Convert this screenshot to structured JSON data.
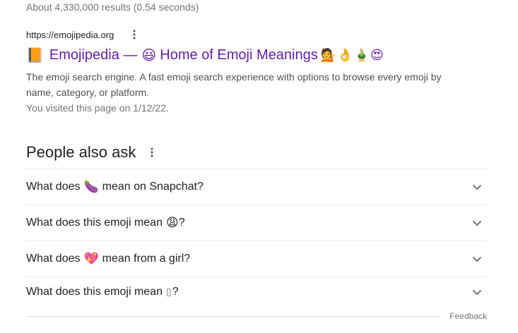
{
  "stats": "About 4,330,000 results (0.54 seconds)",
  "result": {
    "url": "https://emojipedia.org",
    "title_prefix_emoji": "📙",
    "title_part1": "Emojipedia —",
    "title_mid_emoji": "😃",
    "title_part2": "Home of Emoji Meanings",
    "title_suffix_emojis": "💁👌🎍😍",
    "snippet": "The emoji search engine. A fast emoji search experience with options to browse every emoji by name, category, or platform.",
    "visited": "You visited this page on 1/12/22."
  },
  "people_also_ask": {
    "heading": "People also ask",
    "questions": [
      {
        "before": "What does",
        "emoji": "🍆",
        "after": "mean on Snapchat?"
      },
      {
        "before": "What does this emoji mean",
        "emoji": "😩",
        "after": "?"
      },
      {
        "before": "What does",
        "emoji": "💖",
        "after": "mean from a girl?"
      },
      {
        "before": "What does this emoji mean",
        "emoji": "▯",
        "after": "?"
      }
    ]
  },
  "footer": {
    "feedback": "Feedback"
  },
  "colors": {
    "visited_link": "#681da8",
    "text": "#202124",
    "muted": "#70757a",
    "snippet": "#4d5156",
    "divider": "#e8eaed"
  }
}
